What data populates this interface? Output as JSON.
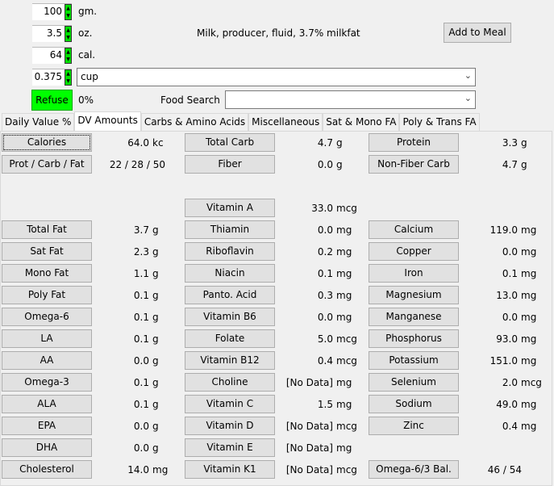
{
  "amounts": [
    {
      "value": "100",
      "unit": "gm."
    },
    {
      "value": "3.5",
      "unit": "oz."
    },
    {
      "value": "64",
      "unit": "cal."
    },
    {
      "value": "0.375"
    }
  ],
  "measure_combo": "cup",
  "food_name": "Milk, producer, fluid, 3.7% milkfat",
  "add_to_meal": "Add to Meal",
  "refuse": {
    "label": "Refuse",
    "value": "0%",
    "color": "#00ff00"
  },
  "food_search": {
    "label": "Food Search",
    "value": ""
  },
  "tabs": [
    "Daily Value %",
    "DV Amounts",
    "Carbs & Amino Acids",
    "Miscellaneous",
    "Sat & Mono FA",
    "Poly & Trans FA"
  ],
  "active_tab": "DV Amounts",
  "columns": [
    [
      {
        "row": 0,
        "label": "Calories",
        "value": "64.0",
        "unit": "kc"
      },
      {
        "row": 1,
        "label": "Prot / Carb / Fat",
        "value": "22 / 28 / 50",
        "unit": ""
      },
      {
        "row": 4,
        "label": "Total Fat",
        "value": "3.7",
        "unit": "g"
      },
      {
        "row": 5,
        "label": "Sat Fat",
        "value": "2.3",
        "unit": "g"
      },
      {
        "row": 6,
        "label": "Mono Fat",
        "value": "1.1",
        "unit": "g"
      },
      {
        "row": 7,
        "label": "Poly Fat",
        "value": "0.1",
        "unit": "g"
      },
      {
        "row": 8,
        "label": "Omega-6",
        "value": "0.1",
        "unit": "g"
      },
      {
        "row": 9,
        "label": "LA",
        "value": "0.1",
        "unit": "g"
      },
      {
        "row": 10,
        "label": "AA",
        "value": "0.0",
        "unit": "g"
      },
      {
        "row": 11,
        "label": "Omega-3",
        "value": "0.1",
        "unit": "g"
      },
      {
        "row": 12,
        "label": "ALA",
        "value": "0.1",
        "unit": "g"
      },
      {
        "row": 13,
        "label": "EPA",
        "value": "0.0",
        "unit": "g"
      },
      {
        "row": 14,
        "label": "DHA",
        "value": "0.0",
        "unit": "g"
      },
      {
        "row": 15,
        "label": "Cholesterol",
        "value": "14.0",
        "unit": "mg"
      }
    ],
    [
      {
        "row": 0,
        "label": "Total Carb",
        "value": "4.7",
        "unit": "g"
      },
      {
        "row": 1,
        "label": "Fiber",
        "value": "0.0",
        "unit": "g"
      },
      {
        "row": 3,
        "label": "Vitamin A",
        "value": "33.0",
        "unit": "mcg"
      },
      {
        "row": 4,
        "label": "Thiamin",
        "value": "0.0",
        "unit": "mg"
      },
      {
        "row": 5,
        "label": "Riboflavin",
        "value": "0.2",
        "unit": "mg"
      },
      {
        "row": 6,
        "label": "Niacin",
        "value": "0.1",
        "unit": "mg"
      },
      {
        "row": 7,
        "label": "Panto. Acid",
        "value": "0.3",
        "unit": "mg"
      },
      {
        "row": 8,
        "label": "Vitamin B6",
        "value": "0.0",
        "unit": "mg"
      },
      {
        "row": 9,
        "label": "Folate",
        "value": "5.0",
        "unit": "mcg"
      },
      {
        "row": 10,
        "label": "Vitamin B12",
        "value": "0.4",
        "unit": "mcg"
      },
      {
        "row": 11,
        "label": "Choline",
        "value": "[No Data]",
        "unit": "mg"
      },
      {
        "row": 12,
        "label": "Vitamin C",
        "value": "1.5",
        "unit": "mg"
      },
      {
        "row": 13,
        "label": "Vitamin D",
        "value": "[No Data]",
        "unit": "mcg"
      },
      {
        "row": 14,
        "label": "Vitamin E",
        "value": "[No Data]",
        "unit": "mg"
      },
      {
        "row": 15,
        "label": "Vitamin K1",
        "value": "[No Data]",
        "unit": "mcg"
      }
    ],
    [
      {
        "row": 0,
        "label": "Protein",
        "value": "3.3",
        "unit": "g"
      },
      {
        "row": 1,
        "label": "Non-Fiber Carb",
        "value": "4.7",
        "unit": "g"
      },
      {
        "row": 4,
        "label": "Calcium",
        "value": "119.0",
        "unit": "mg"
      },
      {
        "row": 5,
        "label": "Copper",
        "value": "0.0",
        "unit": "mg"
      },
      {
        "row": 6,
        "label": "Iron",
        "value": "0.1",
        "unit": "mg"
      },
      {
        "row": 7,
        "label": "Magnesium",
        "value": "13.0",
        "unit": "mg"
      },
      {
        "row": 8,
        "label": "Manganese",
        "value": "0.0",
        "unit": "mg"
      },
      {
        "row": 9,
        "label": "Phosphorus",
        "value": "93.0",
        "unit": "mg"
      },
      {
        "row": 10,
        "label": "Potassium",
        "value": "151.0",
        "unit": "mg"
      },
      {
        "row": 11,
        "label": "Selenium",
        "value": "2.0",
        "unit": "mcg"
      },
      {
        "row": 12,
        "label": "Sodium",
        "value": "49.0",
        "unit": "mg"
      },
      {
        "row": 13,
        "label": "Zinc",
        "value": "0.4",
        "unit": "mg"
      },
      {
        "row": 15,
        "label": "Omega-6/3 Bal.",
        "value": "46 / 54",
        "unit": ""
      }
    ]
  ]
}
